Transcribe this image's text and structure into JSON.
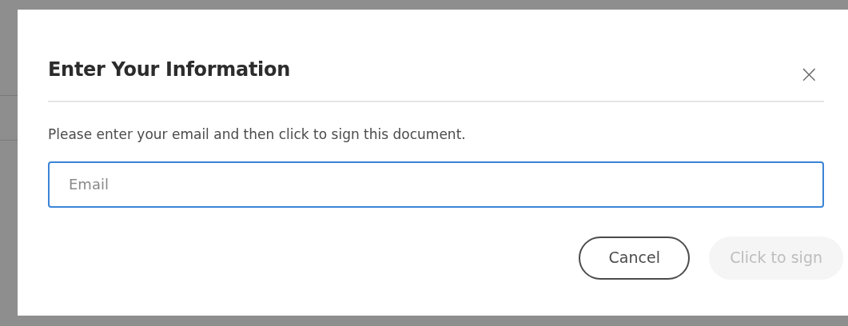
{
  "dialog": {
    "title": "Enter Your Information",
    "close_label": "×",
    "message": "Please enter your email and then click to sign this document.",
    "email": {
      "placeholder": "Email",
      "focused": true
    },
    "buttons": [
      {
        "label": "Cancel",
        "kind": "outline",
        "disabled": false
      },
      {
        "label": "Click to sign",
        "kind": "primary",
        "disabled": true
      }
    ]
  }
}
